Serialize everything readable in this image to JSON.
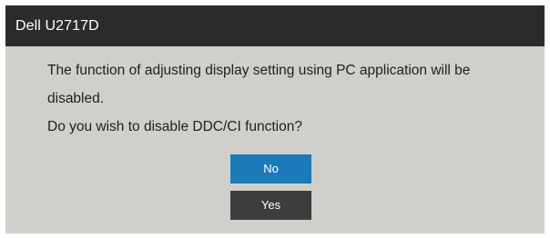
{
  "window": {
    "title": "Dell U2717D"
  },
  "dialog": {
    "message_line1": "The function of adjusting display setting using PC application will be",
    "message_line2": "disabled.",
    "question": "Do you wish to disable DDC/CI function?"
  },
  "buttons": {
    "no_label": "No",
    "yes_label": "Yes"
  },
  "colors": {
    "title_bar": "#2b2b2b",
    "panel": "#cfcfcb",
    "selected_button": "#1c7ab9",
    "unselected_button": "#3d3d3d"
  }
}
